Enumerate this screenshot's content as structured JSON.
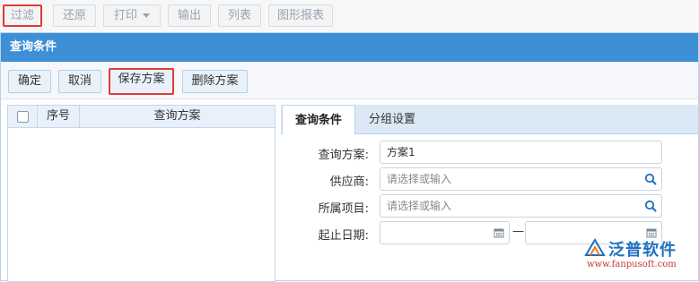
{
  "toolbar": {
    "filter": "过滤",
    "restore": "还原",
    "print": "打印",
    "export": "输出",
    "list": "列表",
    "chart_report": "图形报表"
  },
  "panel": {
    "title": "查询条件",
    "actions": {
      "confirm": "确定",
      "cancel": "取消",
      "save_scheme": "保存方案",
      "delete_scheme": "删除方案"
    }
  },
  "scheme_grid": {
    "columns": [
      "序号",
      "查询方案"
    ],
    "rows": []
  },
  "tabs": [
    {
      "label": "查询条件",
      "active": true
    },
    {
      "label": "分组设置",
      "active": false
    }
  ],
  "form": {
    "scheme_label": "查询方案:",
    "scheme_value": "方案1",
    "supplier_label": "供应商:",
    "supplier_placeholder": "请选择或输入",
    "project_label": "所属项目:",
    "project_placeholder": "请选择或输入",
    "date_label": "起止日期:",
    "date_separator": "—"
  },
  "watermark": {
    "brand": "泛普软件",
    "url": "www.fanpusoft.com"
  },
  "colors": {
    "header_blue": "#3d8fd6",
    "highlight_red": "#e03a3a",
    "brand_blue": "#1f6fc0"
  }
}
